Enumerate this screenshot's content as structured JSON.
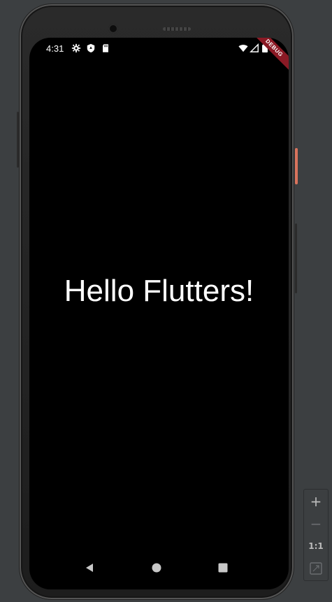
{
  "status_bar": {
    "time": "4:31",
    "left_icons": [
      "gear-icon",
      "shield-icon",
      "sd-card-icon"
    ],
    "right_icons": [
      "wifi-icon",
      "signal-icon",
      "battery-icon"
    ]
  },
  "debug_banner": {
    "label": "DEBUG",
    "color": "#8b1a25"
  },
  "app": {
    "center_text": "Hello Flutters!"
  },
  "nav_bar": {
    "buttons": [
      "back-triangle-icon",
      "home-circle-icon",
      "recents-square-icon"
    ]
  },
  "zoom_controls": {
    "zoom_in_label": "+",
    "zoom_out_label": "−",
    "actual_size_label": "1:1",
    "fit_screen_icon": "fit-screen-icon"
  },
  "colors": {
    "background": "#3c3f41",
    "screen": "#000000",
    "text": "#ffffff",
    "accent_button": "#d9735c"
  }
}
